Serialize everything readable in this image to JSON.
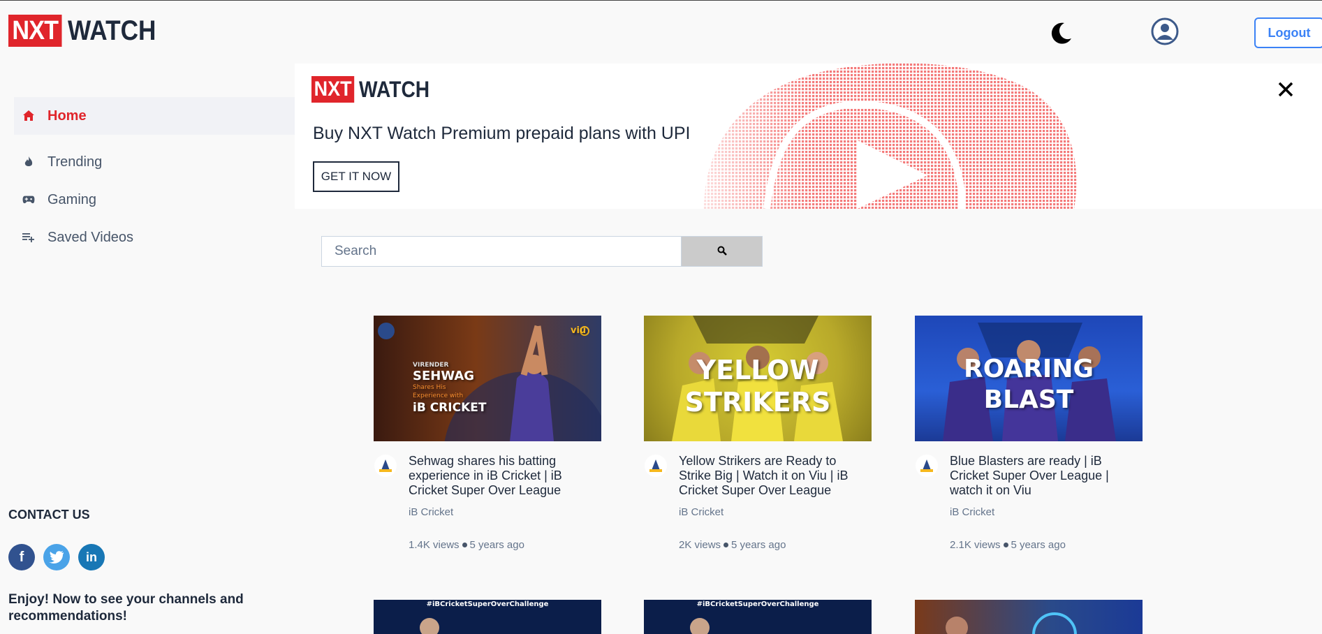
{
  "header": {
    "logo_prefix": "NXT",
    "logo_suffix": "WATCH",
    "logout_label": "Logout"
  },
  "sidebar": {
    "items": [
      {
        "label": "Home",
        "icon": "home-icon",
        "active": true
      },
      {
        "label": "Trending",
        "icon": "fire-icon",
        "active": false
      },
      {
        "label": "Gaming",
        "icon": "gamepad-icon",
        "active": false
      },
      {
        "label": "Saved Videos",
        "icon": "playlist-add-icon",
        "active": false
      }
    ],
    "contact_title": "CONTACT US",
    "socials": [
      "facebook-icon",
      "twitter-icon",
      "linkedin-icon"
    ],
    "enjoy_text": "Enjoy! Now to see your channels and recommendations!"
  },
  "banner": {
    "logo_prefix": "NXT",
    "logo_suffix": "WATCH",
    "text": "Buy NXT Watch Premium prepaid plans with UPI",
    "button_label": "GET IT NOW"
  },
  "search": {
    "placeholder": "Search"
  },
  "videos": [
    {
      "title": "Sehwag shares his batting experience in iB Cricket | iB Cricket Super Over League",
      "channel": "iB Cricket",
      "views": "1.4K views",
      "published": "5 years ago",
      "thumb_lines": [
        "VIRENDER",
        "SEHWAG",
        "Shares His",
        "Experience with",
        "iB CRICKET",
        "viu"
      ]
    },
    {
      "title": "Yellow Strikers are Ready to Strike Big | Watch it on Viu | iB Cricket Super Over League",
      "channel": "iB Cricket",
      "views": "2K views",
      "published": "5 years ago",
      "thumb_lines": [
        "YELLOW",
        "STRIKERS"
      ]
    },
    {
      "title": "Blue Blasters are ready | iB Cricket Super Over League | watch it on Viu",
      "channel": "iB Cricket",
      "views": "2.1K views",
      "published": "5 years ago",
      "thumb_lines": [
        "ROARING",
        "BLAST"
      ]
    },
    {
      "thumb_lines": [
        "#iBCricketSuperOverChallenge"
      ]
    },
    {
      "thumb_lines": [
        "#iBCricketSuperOverChallenge"
      ]
    },
    {
      "thumb_lines": []
    }
  ],
  "colors": {
    "brand_red": "#e0252b",
    "accent_blue": "#3b82f6",
    "text_dark": "#1e293b",
    "text_muted": "#64748b"
  }
}
